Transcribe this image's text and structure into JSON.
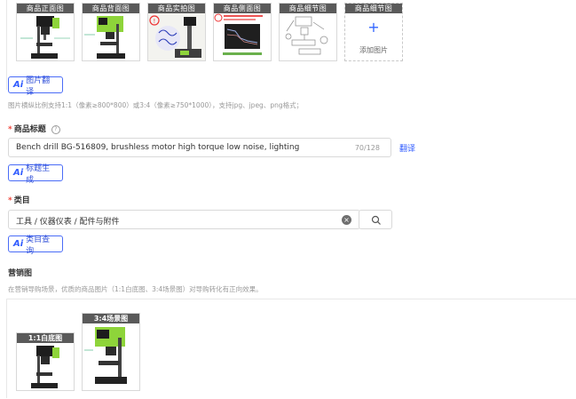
{
  "images": {
    "thumbs": [
      {
        "label": "商品正面图"
      },
      {
        "label": "商品背面图"
      },
      {
        "label": "商品实拍图"
      },
      {
        "label": "商品侧面图"
      },
      {
        "label": "商品细节图"
      }
    ],
    "add_label": "添加图片",
    "add_thumb_label": "商品细节图",
    "translate_button": "图片翻译",
    "hint": "图片横纵比例支持1:1（像素≥800*800）或3:4（像素≥750*1000），支持jpg、jpeg、png格式；"
  },
  "title_section": {
    "required_mark": "*",
    "label": "商品标题",
    "value": "Bench drill BG-516809, brushless motor high torque low noise, lighting",
    "counter": "70/128",
    "translate_link": "翻译",
    "generate_button": "标题生成"
  },
  "category_section": {
    "required_mark": "*",
    "label": "类目",
    "value": "工具 / 仪器仪表 / 配件与附件",
    "query_button": "类目查询"
  },
  "marketing_section": {
    "label": "营销图",
    "hint": "在营销导购场景，优质的商品图片（1:1白底图、3:4场景图）对导购转化有正向效果。",
    "images": [
      {
        "label": "1:1白底图"
      },
      {
        "label": "3:4场景图"
      }
    ]
  },
  "ai_mark": "Ai",
  "colors": {
    "accent": "#2f5bff",
    "required": "#f0483e",
    "drill_green": "#8ed43a"
  }
}
